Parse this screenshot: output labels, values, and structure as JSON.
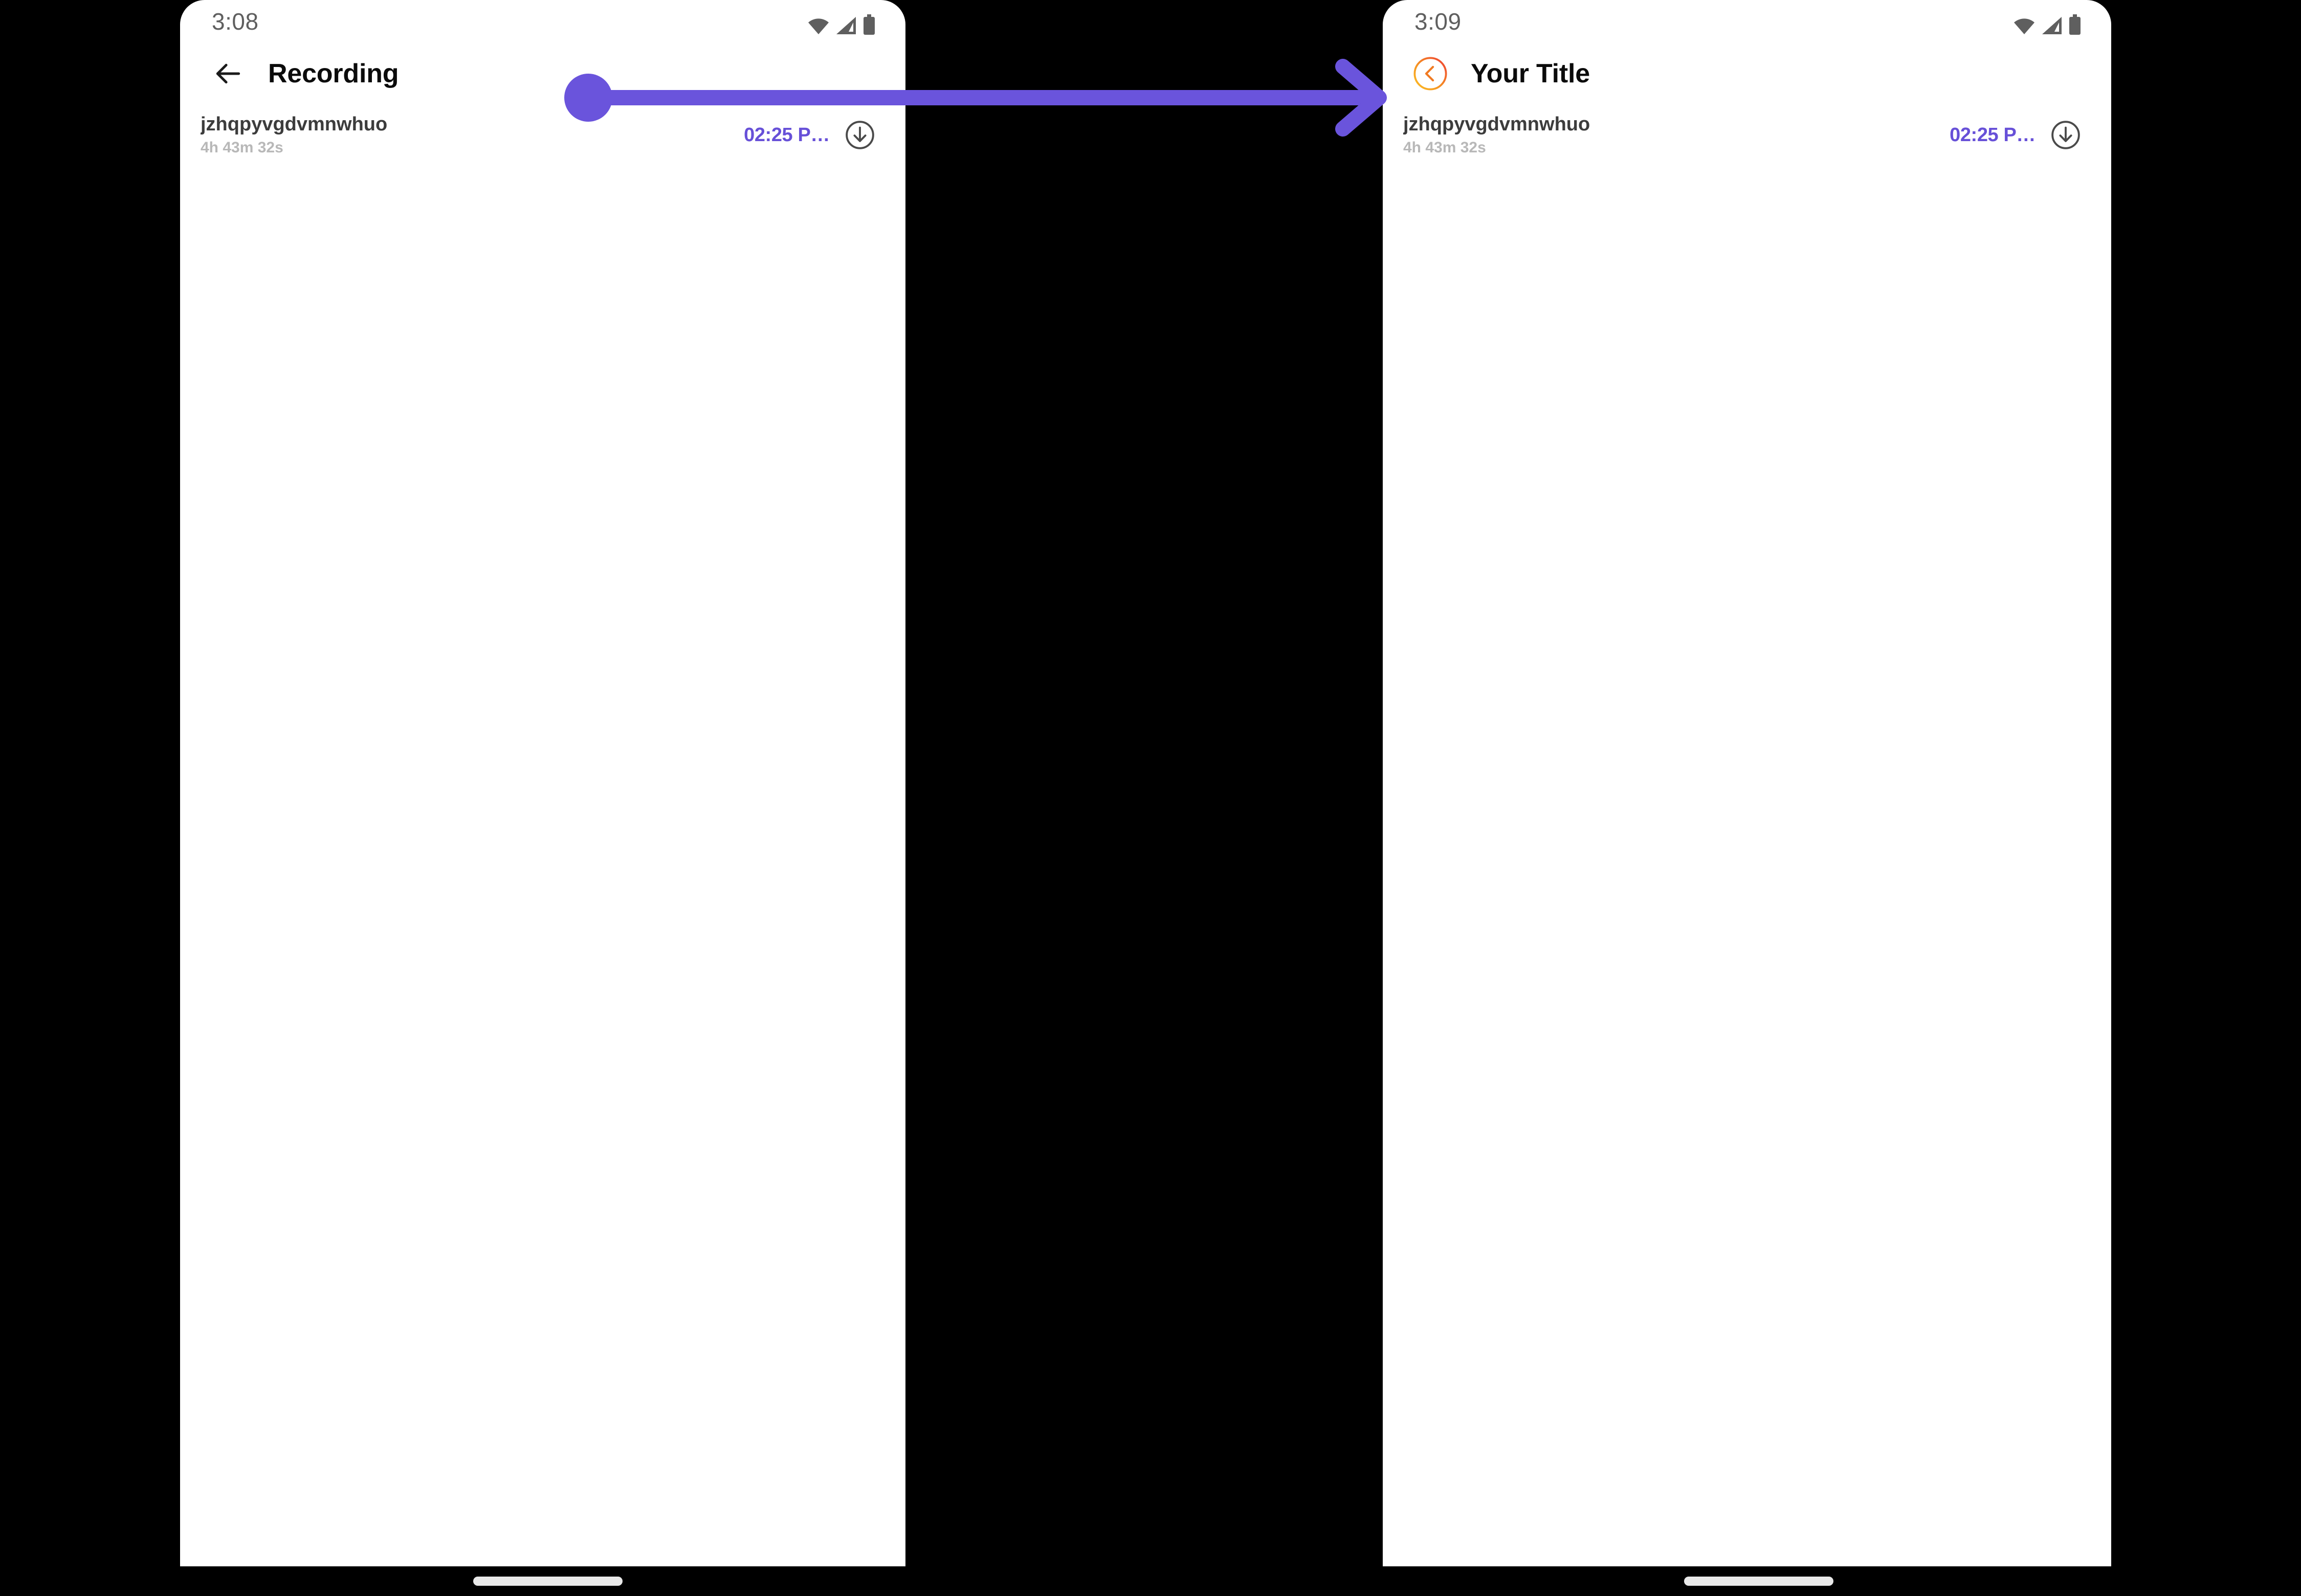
{
  "theme": {
    "accent_purple": "#6750d8",
    "annotation_purple": "#6a54dc",
    "back_circle_gradient_start": "#ef3e33",
    "back_circle_gradient_end": "#fcc024",
    "chevron_orange": "#f07a22",
    "status_icon_gray": "#5f5f5f",
    "title_black": "#0b0b0b",
    "item_title_gray": "#3c3c3c",
    "item_duration_gray": "#b8b8b8",
    "gesture_bar_gray": "#e8e8e8",
    "background_black": "#000000",
    "panel_white": "#ffffff"
  },
  "screens": [
    {
      "id": "before",
      "status_bar": {
        "time": "3:08",
        "icons": [
          "wifi-icon",
          "cellular-signal-icon",
          "battery-icon"
        ]
      },
      "app_bar": {
        "back_icon": "arrow-left-icon",
        "title": "Recording"
      },
      "recordings": [
        {
          "title": "jzhqpyvgdvmnwhuo",
          "duration": "4h 43m 32s",
          "time": "02:25 P…",
          "action_icon": "download-circle-icon"
        }
      ]
    },
    {
      "id": "after",
      "status_bar": {
        "time": "3:09",
        "icons": [
          "wifi-icon",
          "cellular-signal-icon",
          "battery-icon"
        ]
      },
      "app_bar": {
        "back_icon": "chevron-left-circle-gradient-icon",
        "title": "Your Title"
      },
      "recordings": [
        {
          "title": "jzhqpyvgdvmnwhuo",
          "duration": "4h 43m 32s",
          "time": "02:25 P…",
          "action_icon": "download-circle-icon"
        }
      ]
    }
  ],
  "annotation": {
    "type": "arrow",
    "label": "transition-arrow",
    "from": "before-screen-app-bar",
    "to": "after-screen-back-button"
  }
}
